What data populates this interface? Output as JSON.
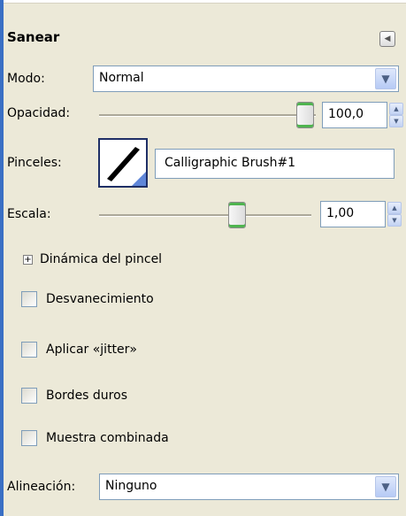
{
  "panel": {
    "title": "Sanear",
    "collapse_icon": "triangle-left-icon"
  },
  "modo": {
    "label": "Modo:",
    "value": "Normal"
  },
  "opacidad": {
    "label": "Opacidad:",
    "value": "100,0",
    "level": 1.0
  },
  "pinceles": {
    "label": "Pinceles:",
    "brush_name": "Calligraphic Brush#1"
  },
  "escala": {
    "label": "Escala:",
    "value": "1,00",
    "level": 0.62
  },
  "dinamica": {
    "label": "Dinámica del pincel"
  },
  "checks": [
    {
      "label": "Desvanecimiento"
    },
    {
      "label": "Aplicar «jitter»"
    },
    {
      "label": "Bordes duros"
    },
    {
      "label": "Muestra combinada"
    }
  ],
  "alineacion": {
    "label": "Alineación:",
    "value": "Ninguno"
  },
  "colors": {
    "accent": "#3a6fc4",
    "slider_green": "#4fb44f",
    "background": "#ece9d8"
  }
}
